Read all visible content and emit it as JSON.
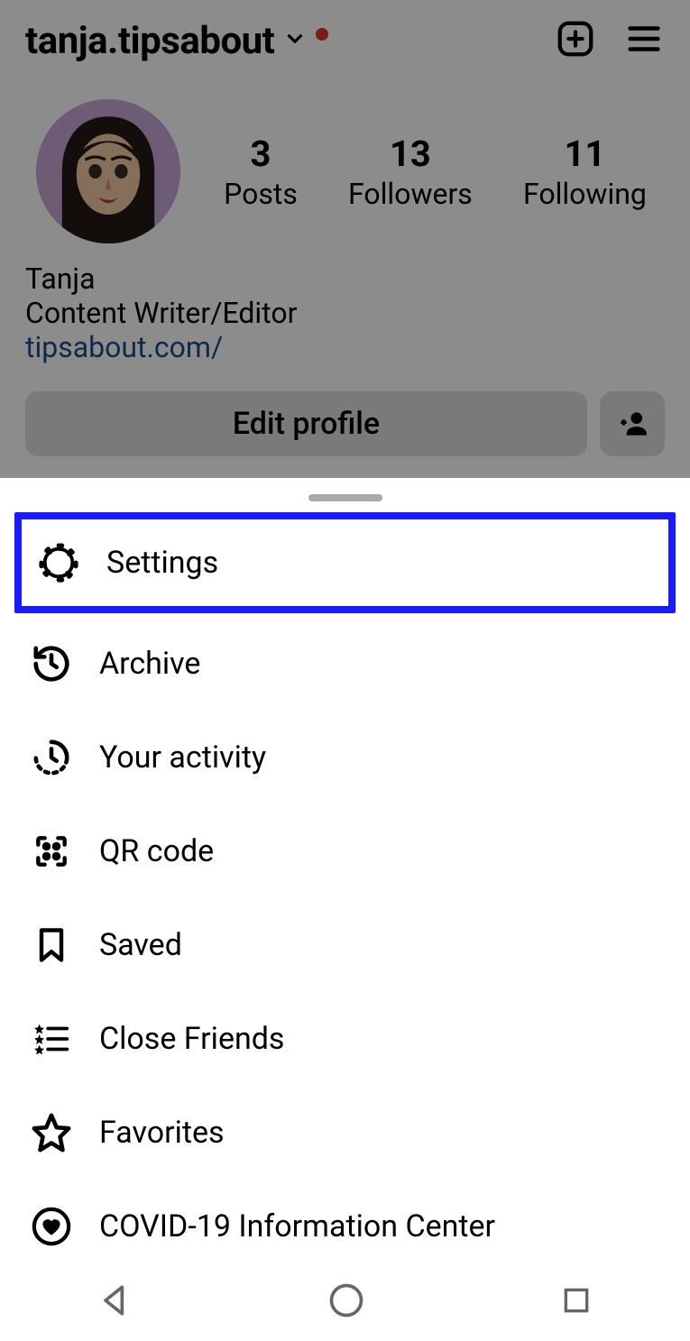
{
  "header": {
    "username": "tanja.tipsabout"
  },
  "stats": {
    "posts": {
      "count": "3",
      "label": "Posts"
    },
    "followers": {
      "count": "13",
      "label": "Followers"
    },
    "following": {
      "count": "11",
      "label": "Following"
    }
  },
  "bio": {
    "name": "Tanja",
    "title": "Content Writer/Editor",
    "link": "tipsabout.com/"
  },
  "buttons": {
    "edit": "Edit profile"
  },
  "menu": {
    "settings": "Settings",
    "archive": "Archive",
    "activity": "Your activity",
    "qr": "QR code",
    "saved": "Saved",
    "close_friends": "Close Friends",
    "favorites": "Favorites",
    "covid": "COVID-19 Information Center"
  },
  "highlighted": "settings"
}
